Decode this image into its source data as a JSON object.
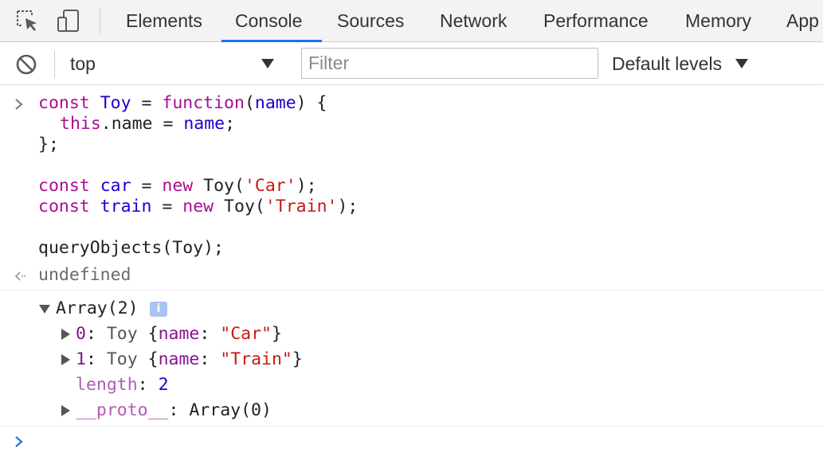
{
  "colors": {
    "accent": "#1a73e8",
    "keyword": "#aa0d91",
    "variable": "#1c00cf",
    "string": "#c41a16",
    "property": "#881391"
  },
  "tabbar": {
    "icons": [
      "inspect-element-icon",
      "device-toolbar-icon"
    ],
    "tabs": [
      "Elements",
      "Console",
      "Sources",
      "Network",
      "Performance",
      "Memory",
      "App"
    ],
    "active_tab": "Console"
  },
  "toolbar": {
    "clear_icon": "clear-console-icon",
    "context": "top",
    "filter_placeholder": "Filter",
    "filter_value": "",
    "levels": "Default levels"
  },
  "input": {
    "l1_kw": "const",
    "l1_name": "Toy",
    "l1_eq": " = ",
    "l1_fn": "function",
    "l1_paren_open": "(",
    "l1_param": "name",
    "l1_rest": ") {",
    "l2_this": "this",
    "l2_mid": ".name = ",
    "l2_val": "name",
    "l2_end": ";",
    "l3": "};",
    "l5_kw": "const",
    "l5_name": "car",
    "l5_eq": " = ",
    "l5_new": "new",
    "l5_call": " Toy(",
    "l5_str": "'Car'",
    "l5_end": ");",
    "l6_kw": "const",
    "l6_name": "train",
    "l6_eq": " = ",
    "l6_new": "new",
    "l6_call": " Toy(",
    "l6_str": "'Train'",
    "l6_end": ");",
    "l8": "queryObjects(Toy);"
  },
  "output": {
    "undefined": "undefined",
    "array_label": "Array(2)",
    "info_badge": "i",
    "items": [
      {
        "index": "0",
        "class": "Toy",
        "open": " {",
        "key": "name",
        "colon": ": ",
        "value": "\"Car\"",
        "close": "}"
      },
      {
        "index": "1",
        "class": "Toy",
        "open": " {",
        "key": "name",
        "colon": ": ",
        "value": "\"Train\"",
        "close": "}"
      }
    ],
    "length_key": "length",
    "length_value": "2",
    "proto_key": "__proto__",
    "proto_value": "Array(0)"
  }
}
